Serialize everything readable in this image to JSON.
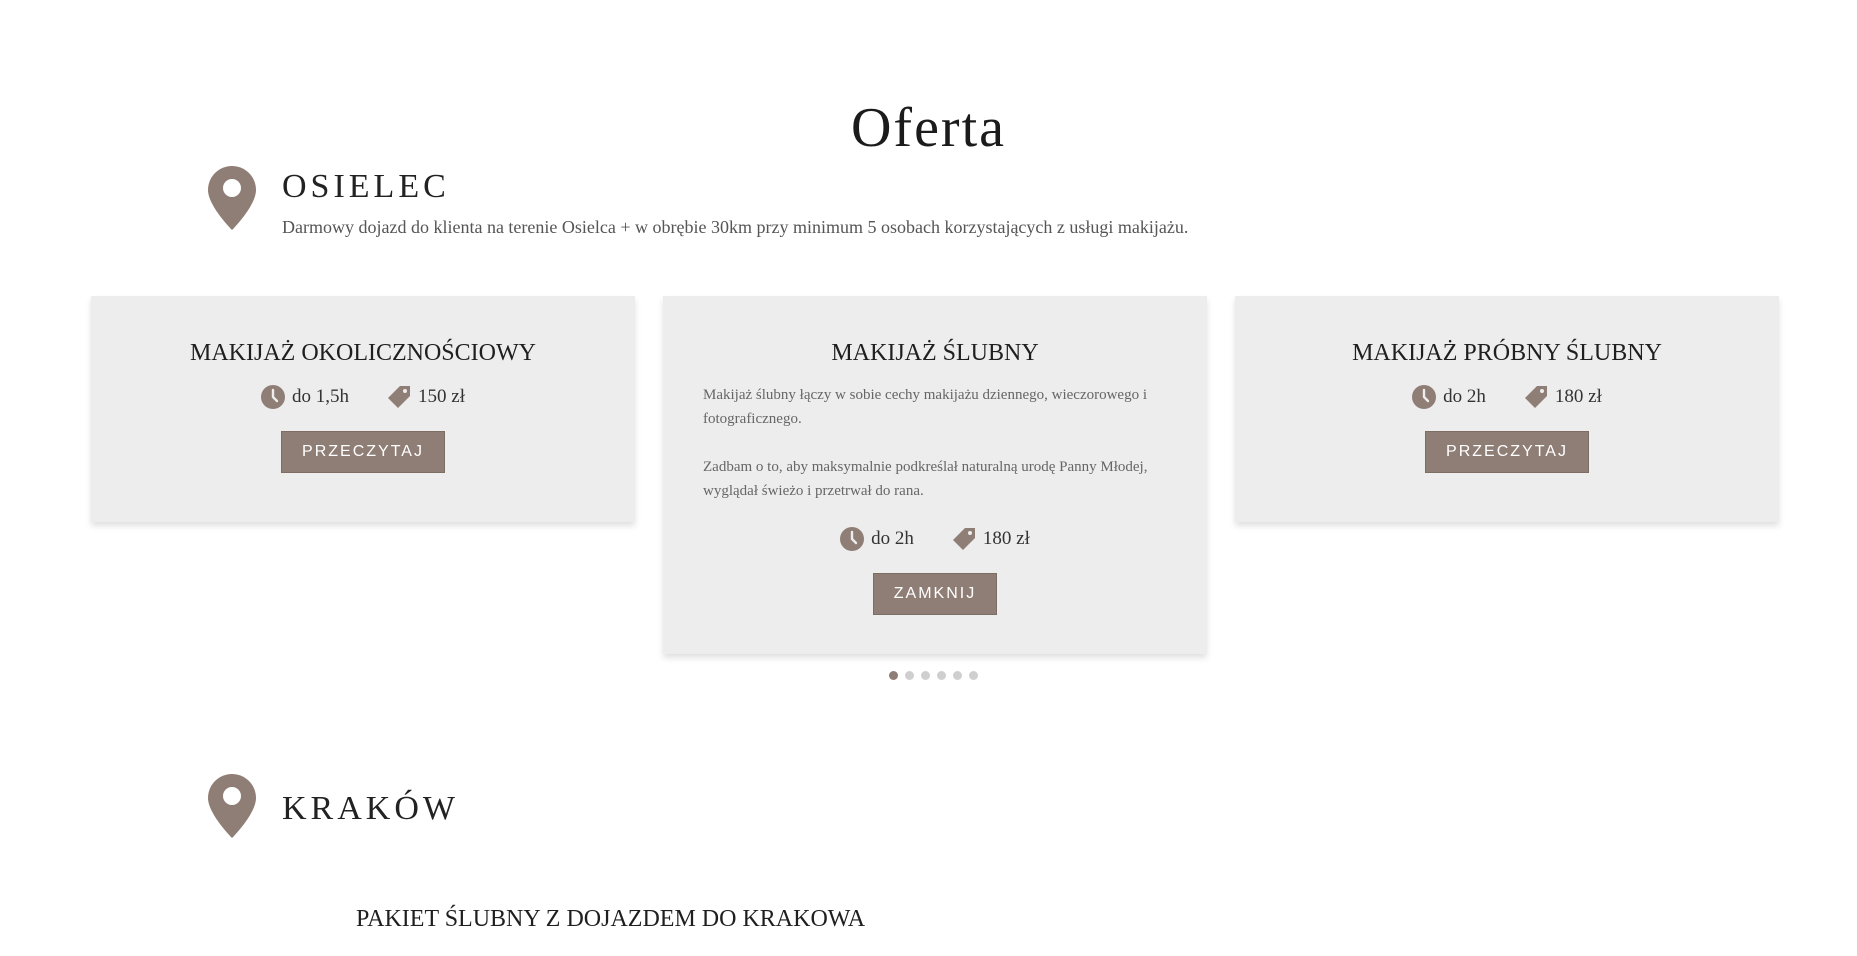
{
  "page": {
    "title": "Oferta"
  },
  "colors": {
    "accent": "#8f7e76",
    "card_bg": "#ededed"
  },
  "locations": [
    {
      "name": "OSIELEC",
      "description": "Darmowy dojazd do klienta na terenie Osielca + w obrębie 30km przy minimum 5 osobach korzystających z usługi makijażu.",
      "icon": "map-pin-icon"
    },
    {
      "name": "KRAKÓW",
      "icon": "map-pin-icon"
    }
  ],
  "cards": [
    {
      "title": "MAKIJAŻ OKOLICZNOŚCIOWY",
      "duration": "do 1,5h",
      "price": "150 zł",
      "button": "PRZECZYTAJ"
    },
    {
      "title": "MAKIJAŻ ŚLUBNY",
      "description": [
        "Makijaż ślubny łączy w sobie cechy makijażu dziennego, wieczorowego i fotograficznego.",
        "Zadbam o to, aby maksymalnie podkreślał naturalną urodę Panny Młodej, wyglądał świeżo i przetrwał do rana."
      ],
      "duration": "do 2h",
      "price": "180 zł",
      "button": "ZAMKNIJ"
    },
    {
      "title": "MAKIJAŻ PRÓBNY ŚLUBNY",
      "duration": "do 2h",
      "price": "180 zł",
      "button": "PRZECZYTAJ"
    }
  ],
  "carousel": {
    "page_count": 6,
    "active_index": 0
  },
  "krakow_package": {
    "title": "PAKIET ŚLUBNY Z DOJAZDEM DO KRAKOWA"
  }
}
